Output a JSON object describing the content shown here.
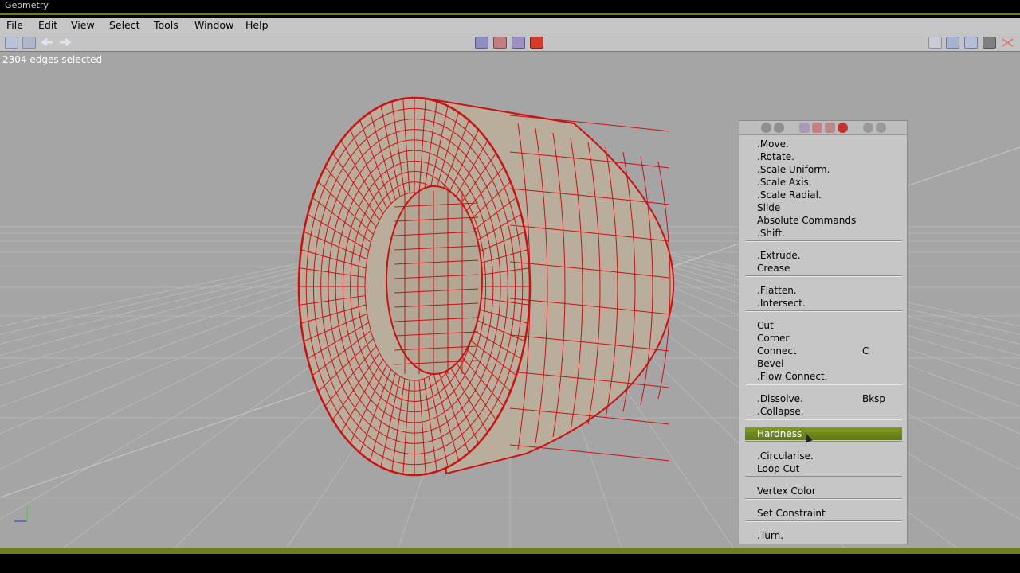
{
  "window": {
    "title": "Geometry"
  },
  "menu": [
    "File",
    "Edit",
    "View",
    "Select",
    "Tools",
    "Window",
    "Help"
  ],
  "status": {
    "text": "2304 edges selected"
  },
  "toolbar": {
    "left_icons": [
      "new-file-icon",
      "save-icon",
      "undo-icon",
      "redo-icon"
    ],
    "center_icons": [
      "vertex-mode-icon",
      "edge-mode-icon",
      "face-mode-icon",
      "body-mode-icon"
    ],
    "right_icons": [
      "ortho-view-icon",
      "workmode-icon",
      "wireframe-icon",
      "shaded-icon",
      "axes-icon"
    ]
  },
  "popup": {
    "header_icons": [
      "rotate-left-icon",
      "rotate-right-icon",
      "vertex-select-icon",
      "edge-select-icon",
      "face-select-icon",
      "object-select-icon",
      "magnet-icon",
      "snap-icon"
    ],
    "items": [
      {
        "label": ".Move."
      },
      {
        "label": ".Rotate."
      },
      {
        "label": ".Scale Uniform."
      },
      {
        "label": ".Scale Axis."
      },
      {
        "label": ".Scale Radial."
      },
      {
        "label": "Slide"
      },
      {
        "label": "Absolute Commands"
      },
      {
        "label": ".Shift."
      },
      {
        "label": ".Extrude."
      },
      {
        "label": "Crease"
      },
      {
        "label": ".Flatten."
      },
      {
        "label": ".Intersect."
      },
      {
        "label": "Cut"
      },
      {
        "label": "Corner"
      },
      {
        "label": "Connect",
        "shortcut": "C"
      },
      {
        "label": "Bevel"
      },
      {
        "label": ".Flow Connect."
      },
      {
        "label": ".Dissolve.",
        "shortcut": "Bksp"
      },
      {
        "label": ".Collapse."
      },
      {
        "label": "Hardness",
        "highlighted": true
      },
      {
        "label": ".Circularise."
      },
      {
        "label": "Loop Cut"
      },
      {
        "label": "Vertex Color"
      },
      {
        "label": "Set Constraint"
      },
      {
        "label": ".Turn."
      }
    ]
  },
  "colors": {
    "accent": "#6e7d23",
    "highlight": "#6f8a1c",
    "wire": "#cc1111",
    "surface": "#b9ae9c",
    "viewport": "#a5a5a5"
  }
}
